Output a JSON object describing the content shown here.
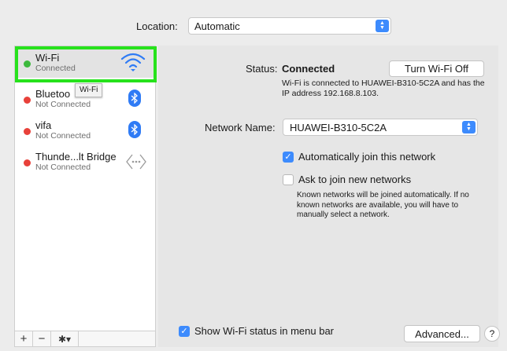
{
  "location": {
    "label": "Location:",
    "value": "Automatic"
  },
  "services": [
    {
      "name": "Wi-Fi",
      "status": "Connected",
      "dot_color": "#3cb93c",
      "icon": "wifi-icon"
    },
    {
      "name": "Bluetoo",
      "status": "Not Connected",
      "dot_color": "#e8413a",
      "icon": "bluetooth-icon"
    },
    {
      "name": "vifa",
      "status": "Not Connected",
      "dot_color": "#e8413a",
      "icon": "bluetooth-icon"
    },
    {
      "name": "Thunde...lt Bridge",
      "status": "Not Connected",
      "dot_color": "#e8413a",
      "icon": "thunderbolt-bridge-icon"
    }
  ],
  "tooltip": "Wi-Fi",
  "toolbar": {
    "add": "+",
    "remove": "−",
    "action": "✱▾"
  },
  "detail": {
    "status_label": "Status:",
    "status_value": "Connected",
    "turn_off_label": "Turn Wi-Fi Off",
    "status_description": "Wi-Fi is connected to HUAWEI-B310-5C2A and has the IP address 192.168.8.103.",
    "network_name_label": "Network Name:",
    "network_name_value": "HUAWEI-B310-5C2A",
    "auto_join_label": "Automatically join this network",
    "ask_join_label": "Ask to join new networks",
    "ask_join_help": "Known networks will be joined automatically. If no known networks are available, you will have to manually select a network.",
    "show_status_label": "Show Wi-Fi status in menu bar",
    "advanced_label": "Advanced...",
    "help_label": "?"
  },
  "checkboxes": {
    "auto_join": true,
    "ask_join": false,
    "show_status": true
  },
  "colors": {
    "accent": "#3d8bfd",
    "highlight": "#27e21c",
    "connected": "#3cb93c",
    "disconnected": "#e8413a"
  }
}
